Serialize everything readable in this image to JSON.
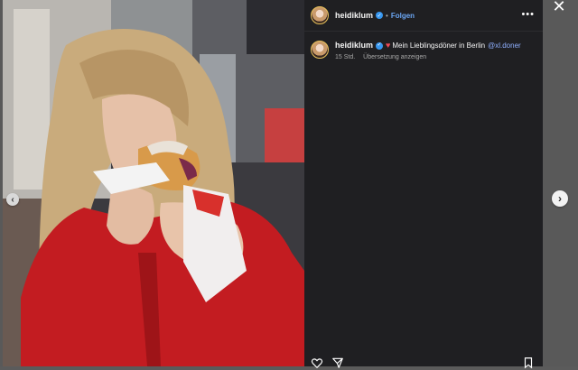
{
  "post": {
    "username": "heidiklum",
    "follow_label": "Folgen",
    "more_icon": "more-options-icon",
    "caption_text": "Mein Lieblingsdöner in Berlin",
    "caption_mention": "@xl.doner",
    "time_ago": "15 Std.",
    "translate_label": "Übersetzung anzeigen"
  },
  "colors": {
    "panel_bg": "#1f1f22",
    "link_blue": "#6ba7f5",
    "heart_red": "#ed4956",
    "verified_blue": "#3797f0"
  },
  "icons": {
    "close": "close-icon",
    "prev": "chevron-left-icon",
    "next": "chevron-right-icon",
    "like": "heart-icon",
    "share": "send-icon",
    "save": "bookmark-icon"
  }
}
